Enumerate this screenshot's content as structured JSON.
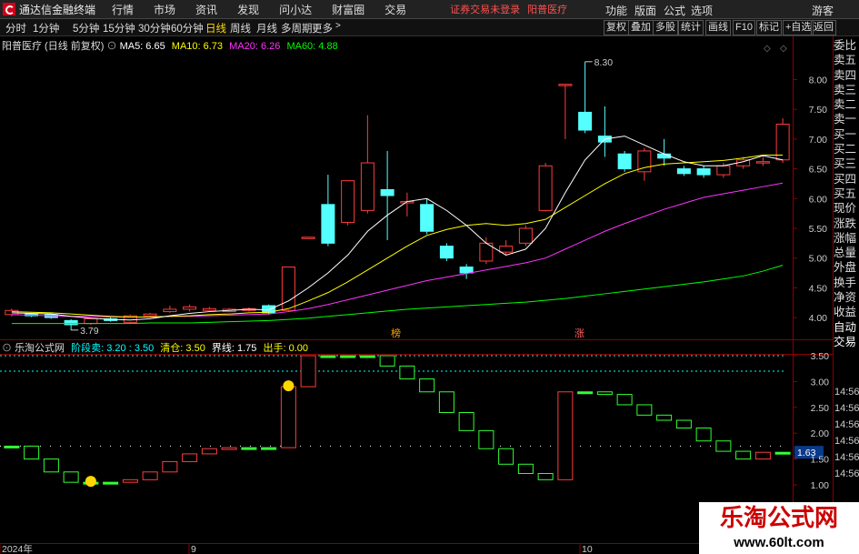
{
  "menubar": {
    "app_title": "通达信金融终端",
    "items": [
      "行情",
      "市场",
      "资讯",
      "发现",
      "问小达",
      "财富圈",
      "交易"
    ],
    "login_warning": "证券交易未登录",
    "stock_name": "阳普医疗",
    "right_items": [
      "功能",
      "版面",
      "公式",
      "选项",
      "游客"
    ]
  },
  "toolbar": {
    "periods": [
      "分时",
      "1分钟",
      "5分钟",
      "15分钟",
      "30分钟",
      "60分钟",
      "日线",
      "周线",
      "月线",
      "多周期",
      "更多"
    ],
    "active": "日线",
    "right_buttons": [
      "复权",
      "叠加",
      "多股",
      "统计",
      "画线",
      "F10",
      "标记",
      "+自选",
      "返回"
    ]
  },
  "main_legend": {
    "title": "阳普医疗 (日线 前复权)",
    "ma5": "MA5: 6.65",
    "ma10": "MA10: 6.73",
    "ma20": "MA20: 6.26",
    "ma60": "MA60: 4.88",
    "colors": {
      "ma5": "#ffffff",
      "ma10": "#ffff00",
      "ma20": "#ff33ff",
      "ma60": "#00ff00"
    }
  },
  "sub_legend": {
    "title": "乐淘公式网",
    "stage_sell": "阶段卖: 3.20 : 3.50",
    "clear": "清仓: 3.50",
    "boundary": "界线: 1.75",
    "act": "出手: 0.00"
  },
  "price_axis": [
    "8.00",
    "7.50",
    "7.00",
    "6.50",
    "6.00",
    "5.50",
    "5.00",
    "4.50",
    "4.00"
  ],
  "sub_axis": [
    "3.50",
    "3.00",
    "2.50",
    "2.00",
    "1.63",
    "1.50",
    "1.00"
  ],
  "sub_axis_time": [
    "14:56",
    "14:56",
    "14:56",
    "14:56",
    "14:56"
  ],
  "current_sub_value": "1.63",
  "annotations": {
    "high": "8.30",
    "low": "3.79",
    "mark1": "榜",
    "mark2": "涨"
  },
  "date_labels": [
    "2024年",
    "9",
    "10"
  ],
  "right_panel": [
    "委比",
    "卖五",
    "卖四",
    "卖三",
    "卖二",
    "卖一",
    "买一",
    "买二",
    "买三",
    "买四",
    "买五",
    "现价",
    "涨跌",
    "涨幅",
    "总量",
    "外盘",
    "换手",
    "净资",
    "收益",
    "自动",
    "交易"
  ],
  "brand": {
    "name": "乐淘公式网",
    "url": "www.60lt.com"
  },
  "chart_data": {
    "type": "candlestick",
    "candles": [
      {
        "o": 4.05,
        "c": 4.12,
        "h": 4.15,
        "l": 4.02
      },
      {
        "o": 4.06,
        "c": 4.03,
        "h": 4.08,
        "l": 4.01
      },
      {
        "o": 4.05,
        "c": 4.0,
        "h": 4.06,
        "l": 3.98
      },
      {
        "o": 3.95,
        "c": 3.88,
        "h": 3.97,
        "l": 3.79
      },
      {
        "o": 3.9,
        "c": 3.98,
        "h": 4.0,
        "l": 3.88
      },
      {
        "o": 3.98,
        "c": 3.95,
        "h": 4.01,
        "l": 3.93
      },
      {
        "o": 3.92,
        "c": 4.03,
        "h": 4.05,
        "l": 3.9
      },
      {
        "o": 4.03,
        "c": 4.06,
        "h": 4.08,
        "l": 4.0
      },
      {
        "o": 4.1,
        "c": 4.14,
        "h": 4.2,
        "l": 4.08
      },
      {
        "o": 4.14,
        "c": 4.18,
        "h": 4.22,
        "l": 4.1
      },
      {
        "o": 4.12,
        "c": 4.15,
        "h": 4.18,
        "l": 4.1
      },
      {
        "o": 4.1,
        "c": 4.14,
        "h": 4.16,
        "l": 4.09
      },
      {
        "o": 4.12,
        "c": 4.15,
        "h": 4.17,
        "l": 4.1
      },
      {
        "o": 4.2,
        "c": 4.08,
        "h": 4.22,
        "l": 4.05
      },
      {
        "o": 4.12,
        "c": 4.85,
        "h": 4.85,
        "l": 4.1
      },
      {
        "o": 5.35,
        "c": 5.35,
        "h": 5.35,
        "l": 5.35
      },
      {
        "o": 5.9,
        "c": 5.25,
        "h": 6.4,
        "l": 5.2
      },
      {
        "o": 5.6,
        "c": 6.3,
        "h": 6.3,
        "l": 5.55
      },
      {
        "o": 5.8,
        "c": 6.6,
        "h": 7.4,
        "l": 5.75
      },
      {
        "o": 6.15,
        "c": 6.05,
        "h": 6.8,
        "l": 5.3
      },
      {
        "o": 5.95,
        "c": 5.95,
        "h": 6.1,
        "l": 5.7
      },
      {
        "o": 5.9,
        "c": 5.45,
        "h": 6.0,
        "l": 5.4
      },
      {
        "o": 5.2,
        "c": 5.0,
        "h": 5.25,
        "l": 4.95
      },
      {
        "o": 4.85,
        "c": 4.75,
        "h": 4.9,
        "l": 4.65
      },
      {
        "o": 4.95,
        "c": 5.25,
        "h": 5.35,
        "l": 4.9
      },
      {
        "o": 5.1,
        "c": 5.2,
        "h": 5.3,
        "l": 5.05
      },
      {
        "o": 5.25,
        "c": 5.5,
        "h": 5.55,
        "l": 5.2
      },
      {
        "o": 5.8,
        "c": 6.55,
        "h": 6.6,
        "l": 5.78
      },
      {
        "o": 7.92,
        "c": 7.92,
        "h": 7.92,
        "l": 7.0
      },
      {
        "o": 7.45,
        "c": 7.15,
        "h": 8.3,
        "l": 7.1
      },
      {
        "o": 7.05,
        "c": 6.95,
        "h": 7.55,
        "l": 6.7
      },
      {
        "o": 6.75,
        "c": 6.5,
        "h": 6.8,
        "l": 6.45
      },
      {
        "o": 6.45,
        "c": 6.8,
        "h": 6.85,
        "l": 6.3
      },
      {
        "o": 6.75,
        "c": 6.68,
        "h": 7.0,
        "l": 6.55
      },
      {
        "o": 6.5,
        "c": 6.42,
        "h": 6.55,
        "l": 6.38
      },
      {
        "o": 6.5,
        "c": 6.4,
        "h": 6.55,
        "l": 6.35
      },
      {
        "o": 6.4,
        "c": 6.55,
        "h": 6.6,
        "l": 6.35
      },
      {
        "o": 6.55,
        "c": 6.65,
        "h": 6.7,
        "l": 6.5
      },
      {
        "o": 6.6,
        "c": 6.62,
        "h": 6.7,
        "l": 6.55
      },
      {
        "o": 6.65,
        "c": 7.25,
        "h": 7.35,
        "l": 6.6
      }
    ],
    "ma5": [
      4.08,
      4.07,
      4.06,
      4.02,
      3.99,
      3.97,
      3.96,
      3.98,
      4.03,
      4.07,
      4.1,
      4.12,
      4.14,
      4.13,
      4.28,
      4.5,
      4.75,
      5.05,
      5.45,
      5.72,
      5.95,
      6.0,
      5.8,
      5.55,
      5.25,
      5.05,
      5.15,
      5.5,
      6.1,
      6.65,
      7.0,
      7.05,
      6.9,
      6.75,
      6.62,
      6.55,
      6.55,
      6.62,
      6.72,
      6.65
    ],
    "ma10": [
      4.1,
      4.09,
      4.08,
      4.06,
      4.04,
      4.02,
      4.01,
      4.01,
      4.02,
      4.03,
      4.05,
      4.06,
      4.08,
      4.09,
      4.15,
      4.28,
      4.42,
      4.6,
      4.8,
      5.0,
      5.2,
      5.38,
      5.48,
      5.55,
      5.58,
      5.55,
      5.58,
      5.65,
      5.85,
      6.05,
      6.25,
      6.42,
      6.52,
      6.58,
      6.6,
      6.62,
      6.64,
      6.68,
      6.73,
      6.73
    ],
    "ma20": [
      4.05,
      4.04,
      4.03,
      4.02,
      4.02,
      4.01,
      4.01,
      4.01,
      4.02,
      4.02,
      4.03,
      4.04,
      4.05,
      4.06,
      4.1,
      4.15,
      4.22,
      4.3,
      4.38,
      4.46,
      4.54,
      4.62,
      4.68,
      4.74,
      4.8,
      4.86,
      4.92,
      5.0,
      5.15,
      5.3,
      5.45,
      5.58,
      5.7,
      5.82,
      5.92,
      6.02,
      6.08,
      6.14,
      6.2,
      6.26
    ],
    "ma60": [
      3.9,
      3.9,
      3.9,
      3.9,
      3.9,
      3.9,
      3.9,
      3.91,
      3.91,
      3.91,
      3.92,
      3.93,
      3.94,
      3.95,
      3.97,
      3.99,
      4.02,
      4.05,
      4.08,
      4.11,
      4.14,
      4.16,
      4.18,
      4.2,
      4.22,
      4.24,
      4.26,
      4.29,
      4.32,
      4.36,
      4.4,
      4.44,
      4.48,
      4.52,
      4.56,
      4.6,
      4.65,
      4.7,
      4.78,
      4.88
    ],
    "sub_indicator": {
      "values": [
        1.75,
        1.5,
        1.25,
        1.05,
        1.05,
        1.05,
        1.1,
        1.25,
        1.45,
        1.6,
        1.7,
        1.72,
        1.72,
        1.72,
        2.9,
        3.5,
        3.5,
        3.5,
        3.5,
        3.3,
        3.05,
        2.8,
        2.4,
        2.05,
        1.7,
        1.4,
        1.22,
        1.1,
        2.8,
        2.8,
        2.75,
        2.55,
        2.35,
        2.25,
        2.1,
        1.85,
        1.65,
        1.5,
        1.63,
        1.63
      ],
      "ylim": [
        1.0,
        3.5
      ]
    },
    "ylim": [
      3.65,
      8.45
    ]
  }
}
